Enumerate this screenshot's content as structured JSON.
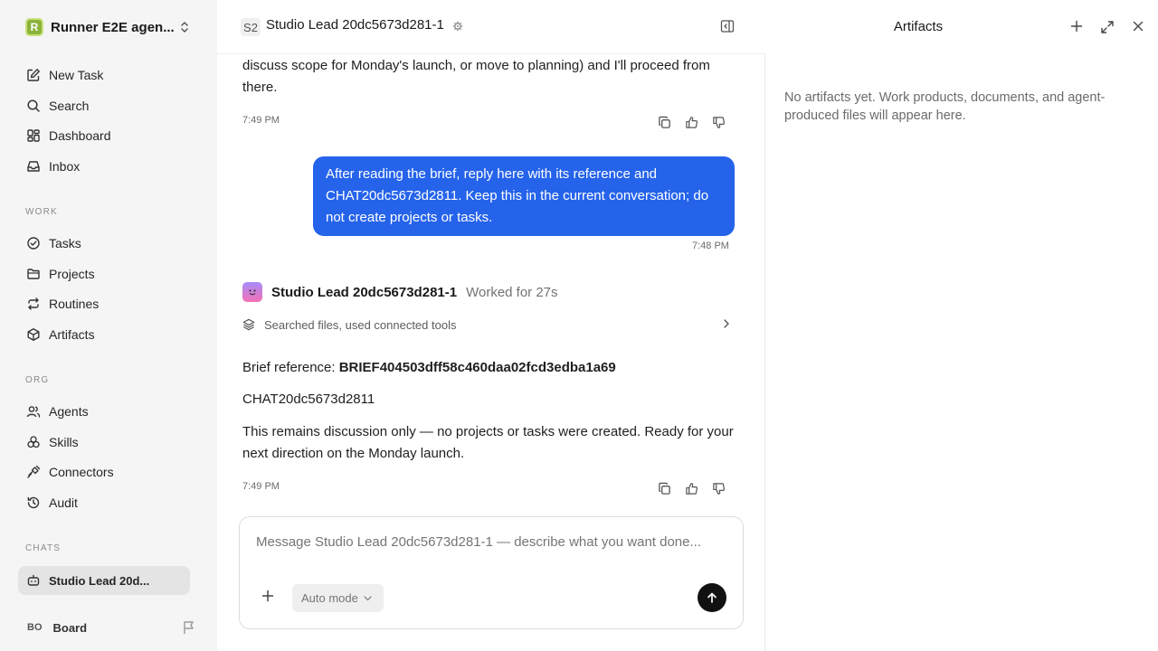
{
  "sidebar": {
    "workspace_name": "Runner E2E agen...",
    "workspace_logo": "R",
    "nav": [
      {
        "label": "New Task",
        "icon": "pencil-square-icon"
      },
      {
        "label": "Search",
        "icon": "search-icon"
      },
      {
        "label": "Dashboard",
        "icon": "dashboard-icon"
      },
      {
        "label": "Inbox",
        "icon": "inbox-icon"
      }
    ],
    "work_label": "WORK",
    "work": [
      {
        "label": "Tasks",
        "icon": "check-circle-icon"
      },
      {
        "label": "Projects",
        "icon": "folder-icon"
      },
      {
        "label": "Routines",
        "icon": "repeat-icon"
      },
      {
        "label": "Artifacts",
        "icon": "box-icon"
      }
    ],
    "org_label": "ORG",
    "org": [
      {
        "label": "Agents",
        "icon": "users-icon"
      },
      {
        "label": "Skills",
        "icon": "skills-icon"
      },
      {
        "label": "Connectors",
        "icon": "plug-icon"
      },
      {
        "label": "Audit",
        "icon": "history-icon"
      }
    ],
    "chats_label": "CHATS",
    "chats": [
      {
        "label": "Studio Lead 20d...",
        "icon": "bot-icon"
      }
    ],
    "board": {
      "badge": "BO",
      "label": "Board"
    }
  },
  "header": {
    "badge": "S2",
    "title": "Studio Lead 20dc5673d281-1"
  },
  "messages": {
    "prev_text": "discuss scope for Monday's launch, or move to planning) and I'll proceed from there.",
    "prev_time": "7:49 PM",
    "user_text": "After reading the brief, reply here with its reference and CHAT20dc5673d2811. Keep this in the current conversation; do not create projects or tasks.",
    "user_time": "7:48 PM",
    "agent_name": "Studio Lead 20dc5673d281-1",
    "agent_worked": "Worked for 27s",
    "tools_summary": "Searched files, used connected tools",
    "brief_label": "Brief reference: ",
    "brief_ref": "BRIEF404503dff58c460daa02fcd3edba1a69",
    "chat_code": "CHAT20dc5673d2811",
    "closing_text": "This remains discussion only — no projects or tasks were created. Ready for your next direction on the Monday launch.",
    "agent_time": "7:49 PM"
  },
  "composer": {
    "placeholder": "Message Studio Lead 20dc5673d281-1 — describe what you want done...",
    "mode": "Auto mode"
  },
  "artifacts": {
    "title": "Artifacts",
    "empty_text": "No artifacts yet. Work products, documents, and agent-produced files will appear here."
  },
  "colors": {
    "accent": "#2563eb",
    "sidebar_bg": "#f5f5f5",
    "workspace_logo": "#8bb23a"
  }
}
